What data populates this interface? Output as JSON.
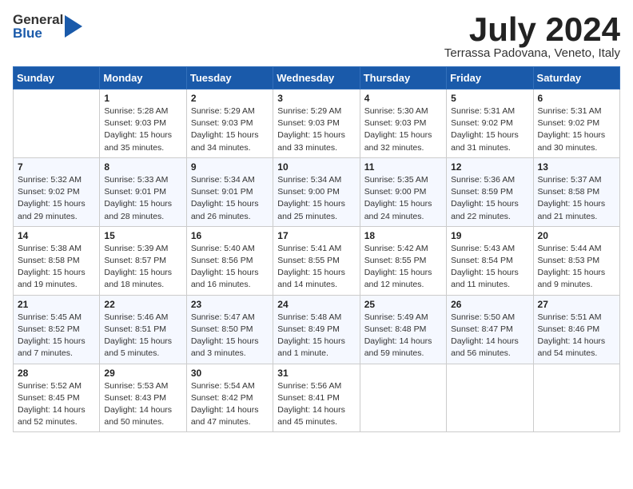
{
  "header": {
    "logo_general": "General",
    "logo_blue": "Blue",
    "month": "July 2024",
    "location": "Terrassa Padovana, Veneto, Italy"
  },
  "weekdays": [
    "Sunday",
    "Monday",
    "Tuesday",
    "Wednesday",
    "Thursday",
    "Friday",
    "Saturday"
  ],
  "weeks": [
    [
      {
        "day": "",
        "content": ""
      },
      {
        "day": "1",
        "content": "Sunrise: 5:28 AM\nSunset: 9:03 PM\nDaylight: 15 hours\nand 35 minutes."
      },
      {
        "day": "2",
        "content": "Sunrise: 5:29 AM\nSunset: 9:03 PM\nDaylight: 15 hours\nand 34 minutes."
      },
      {
        "day": "3",
        "content": "Sunrise: 5:29 AM\nSunset: 9:03 PM\nDaylight: 15 hours\nand 33 minutes."
      },
      {
        "day": "4",
        "content": "Sunrise: 5:30 AM\nSunset: 9:03 PM\nDaylight: 15 hours\nand 32 minutes."
      },
      {
        "day": "5",
        "content": "Sunrise: 5:31 AM\nSunset: 9:02 PM\nDaylight: 15 hours\nand 31 minutes."
      },
      {
        "day": "6",
        "content": "Sunrise: 5:31 AM\nSunset: 9:02 PM\nDaylight: 15 hours\nand 30 minutes."
      }
    ],
    [
      {
        "day": "7",
        "content": "Sunrise: 5:32 AM\nSunset: 9:02 PM\nDaylight: 15 hours\nand 29 minutes."
      },
      {
        "day": "8",
        "content": "Sunrise: 5:33 AM\nSunset: 9:01 PM\nDaylight: 15 hours\nand 28 minutes."
      },
      {
        "day": "9",
        "content": "Sunrise: 5:34 AM\nSunset: 9:01 PM\nDaylight: 15 hours\nand 26 minutes."
      },
      {
        "day": "10",
        "content": "Sunrise: 5:34 AM\nSunset: 9:00 PM\nDaylight: 15 hours\nand 25 minutes."
      },
      {
        "day": "11",
        "content": "Sunrise: 5:35 AM\nSunset: 9:00 PM\nDaylight: 15 hours\nand 24 minutes."
      },
      {
        "day": "12",
        "content": "Sunrise: 5:36 AM\nSunset: 8:59 PM\nDaylight: 15 hours\nand 22 minutes."
      },
      {
        "day": "13",
        "content": "Sunrise: 5:37 AM\nSunset: 8:58 PM\nDaylight: 15 hours\nand 21 minutes."
      }
    ],
    [
      {
        "day": "14",
        "content": "Sunrise: 5:38 AM\nSunset: 8:58 PM\nDaylight: 15 hours\nand 19 minutes."
      },
      {
        "day": "15",
        "content": "Sunrise: 5:39 AM\nSunset: 8:57 PM\nDaylight: 15 hours\nand 18 minutes."
      },
      {
        "day": "16",
        "content": "Sunrise: 5:40 AM\nSunset: 8:56 PM\nDaylight: 15 hours\nand 16 minutes."
      },
      {
        "day": "17",
        "content": "Sunrise: 5:41 AM\nSunset: 8:55 PM\nDaylight: 15 hours\nand 14 minutes."
      },
      {
        "day": "18",
        "content": "Sunrise: 5:42 AM\nSunset: 8:55 PM\nDaylight: 15 hours\nand 12 minutes."
      },
      {
        "day": "19",
        "content": "Sunrise: 5:43 AM\nSunset: 8:54 PM\nDaylight: 15 hours\nand 11 minutes."
      },
      {
        "day": "20",
        "content": "Sunrise: 5:44 AM\nSunset: 8:53 PM\nDaylight: 15 hours\nand 9 minutes."
      }
    ],
    [
      {
        "day": "21",
        "content": "Sunrise: 5:45 AM\nSunset: 8:52 PM\nDaylight: 15 hours\nand 7 minutes."
      },
      {
        "day": "22",
        "content": "Sunrise: 5:46 AM\nSunset: 8:51 PM\nDaylight: 15 hours\nand 5 minutes."
      },
      {
        "day": "23",
        "content": "Sunrise: 5:47 AM\nSunset: 8:50 PM\nDaylight: 15 hours\nand 3 minutes."
      },
      {
        "day": "24",
        "content": "Sunrise: 5:48 AM\nSunset: 8:49 PM\nDaylight: 15 hours\nand 1 minute."
      },
      {
        "day": "25",
        "content": "Sunrise: 5:49 AM\nSunset: 8:48 PM\nDaylight: 14 hours\nand 59 minutes."
      },
      {
        "day": "26",
        "content": "Sunrise: 5:50 AM\nSunset: 8:47 PM\nDaylight: 14 hours\nand 56 minutes."
      },
      {
        "day": "27",
        "content": "Sunrise: 5:51 AM\nSunset: 8:46 PM\nDaylight: 14 hours\nand 54 minutes."
      }
    ],
    [
      {
        "day": "28",
        "content": "Sunrise: 5:52 AM\nSunset: 8:45 PM\nDaylight: 14 hours\nand 52 minutes."
      },
      {
        "day": "29",
        "content": "Sunrise: 5:53 AM\nSunset: 8:43 PM\nDaylight: 14 hours\nand 50 minutes."
      },
      {
        "day": "30",
        "content": "Sunrise: 5:54 AM\nSunset: 8:42 PM\nDaylight: 14 hours\nand 47 minutes."
      },
      {
        "day": "31",
        "content": "Sunrise: 5:56 AM\nSunset: 8:41 PM\nDaylight: 14 hours\nand 45 minutes."
      },
      {
        "day": "",
        "content": ""
      },
      {
        "day": "",
        "content": ""
      },
      {
        "day": "",
        "content": ""
      }
    ]
  ]
}
